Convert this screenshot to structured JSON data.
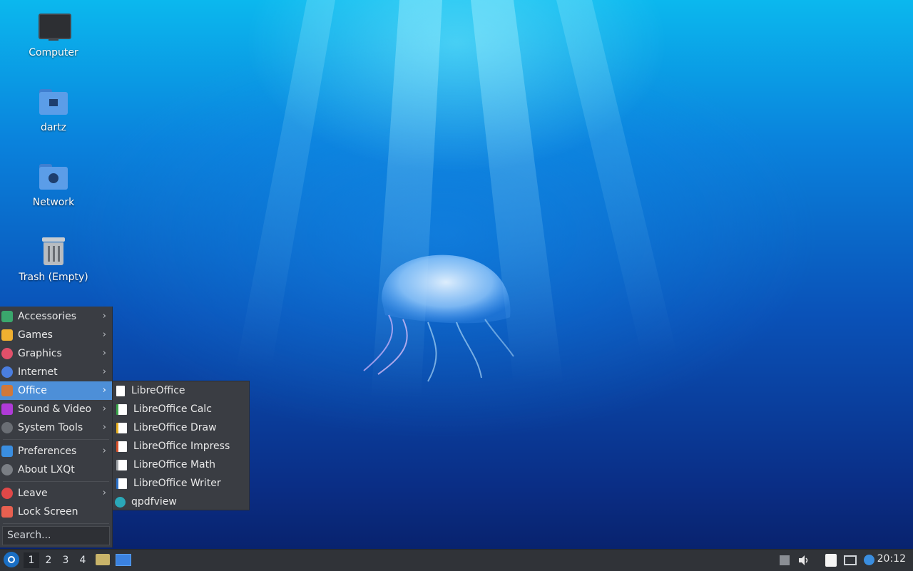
{
  "desktop": {
    "icons": [
      {
        "label": "Computer"
      },
      {
        "label": "dartz"
      },
      {
        "label": "Network"
      },
      {
        "label": "Trash (Empty)"
      }
    ]
  },
  "menu": {
    "items": [
      {
        "label": "Accessories",
        "icon": "accessories-icon",
        "color": "#3aa76d"
      },
      {
        "label": "Games",
        "icon": "games-icon",
        "color": "#f0b030"
      },
      {
        "label": "Graphics",
        "icon": "graphics-icon",
        "color": "#e0506a"
      },
      {
        "label": "Internet",
        "icon": "internet-icon",
        "color": "#4a7ee0"
      },
      {
        "label": "Office",
        "icon": "office-icon",
        "color": "#d0783a"
      },
      {
        "label": "Sound & Video",
        "icon": "sound-video-icon",
        "color": "#b03ad8"
      },
      {
        "label": "System Tools",
        "icon": "system-tools-icon",
        "color": "#6a6e74"
      },
      {
        "label": "Preferences",
        "icon": "preferences-icon",
        "color": "#3a8ee0"
      },
      {
        "label": "About LXQt",
        "icon": "about-icon",
        "color": "#7a7e84"
      },
      {
        "label": "Leave",
        "icon": "power-icon",
        "color": "#e04848"
      },
      {
        "label": "Lock Screen",
        "icon": "lock-icon",
        "color": "#e86050"
      }
    ],
    "active_item": "Office",
    "search_placeholder": "Search..."
  },
  "submenu": {
    "items": [
      {
        "label": "LibreOffice",
        "icon": "libreoffice-icon",
        "color": "#ffffff"
      },
      {
        "label": "LibreOffice Calc",
        "icon": "libreoffice-calc-icon",
        "color": "#3aa64a"
      },
      {
        "label": "LibreOffice Draw",
        "icon": "libreoffice-draw-icon",
        "color": "#e8b020"
      },
      {
        "label": "LibreOffice Impress",
        "icon": "libreoffice-impress-icon",
        "color": "#d8502a"
      },
      {
        "label": "LibreOffice Math",
        "icon": "libreoffice-math-icon",
        "color": "#a0a4a8"
      },
      {
        "label": "LibreOffice Writer",
        "icon": "libreoffice-writer-icon",
        "color": "#2a70c8"
      },
      {
        "label": "qpdfview",
        "icon": "qpdfview-icon",
        "color": "#2aa8b8"
      }
    ]
  },
  "taskbar": {
    "workspaces": [
      "1",
      "2",
      "3",
      "4"
    ],
    "active_workspace": "1",
    "clock": "20:12"
  }
}
